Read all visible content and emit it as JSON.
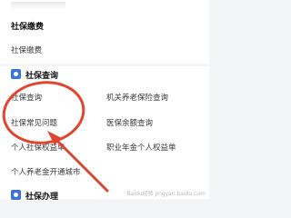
{
  "social_insurance_payment": {
    "title": "社保缴费",
    "item": "社保缴费"
  },
  "social_insurance_query": {
    "title": "社保查询",
    "left_items": [
      "社保查询",
      "社保常见问题",
      "个人社保权益单",
      "个人养老金开通城市"
    ],
    "right_items": [
      "机关养老保险查询",
      "医保余额查询",
      "职业年金个人权益单"
    ]
  },
  "social_insurance_handling": {
    "title": "社保办理"
  },
  "annotation": {
    "stroke_color": "#e0452f"
  },
  "watermark": "Baidu经验 jingyan.baidu.com"
}
